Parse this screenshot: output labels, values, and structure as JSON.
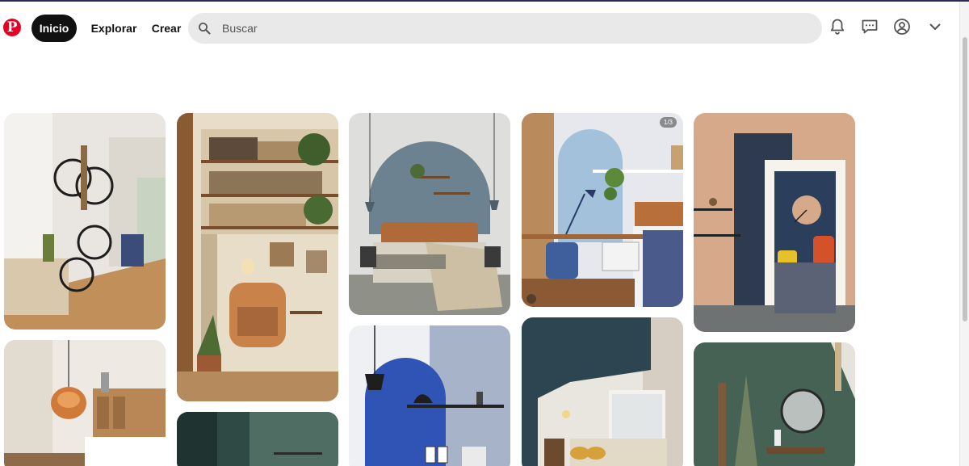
{
  "header": {
    "logo_icon": "pinterest-logo",
    "nav": {
      "home_label": "Inicio",
      "explore_label": "Explorar",
      "create_label": "Crear"
    },
    "search": {
      "placeholder": "Buscar",
      "value": ""
    },
    "icons": [
      "bell-icon",
      "messages-icon",
      "profile-icon",
      "chevron-down-icon"
    ]
  },
  "colors": {
    "brand": "#e60023",
    "active_nav": "#111111",
    "search_bg": "#e9e9e9"
  },
  "pins": [
    {
      "id": "bikes-hallway",
      "badge": ""
    },
    {
      "id": "bookshelf-reading-nook",
      "badge": ""
    },
    {
      "id": "bedroom-blue-arch",
      "badge": ""
    },
    {
      "id": "desk-blue-arch",
      "badge": "1/3"
    },
    {
      "id": "peach-navy-doorway",
      "badge": ""
    },
    {
      "id": "kitchen-pendant",
      "badge": ""
    },
    {
      "id": "green-wall-pin",
      "badge": ""
    },
    {
      "id": "cobalt-arch-shelf",
      "badge": ""
    },
    {
      "id": "bedroom-navy-ceiling",
      "badge": ""
    },
    {
      "id": "green-wall-mirror",
      "badge": ""
    }
  ]
}
